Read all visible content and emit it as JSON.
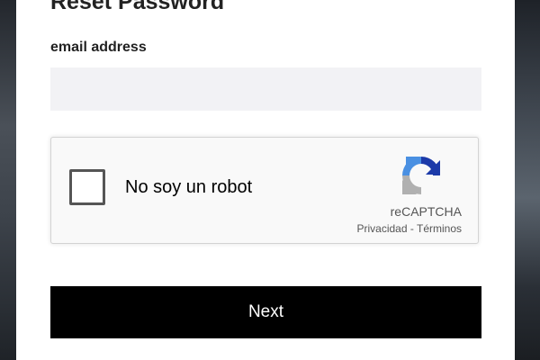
{
  "form": {
    "title": "Reset Password",
    "email_label": "email address",
    "email_value": "",
    "next_label": "Next"
  },
  "recaptcha": {
    "checkbox_label": "No soy un robot",
    "checked": false,
    "brand": "reCAPTCHA",
    "privacy_link": "Privacidad",
    "separator": " - ",
    "terms_link": "Términos",
    "logo_icon": "recaptcha-logo-icon",
    "colors": {
      "blue": "#1c3aa9",
      "light_blue": "#4a90e2",
      "gray": "#b0b0b0"
    }
  },
  "theme": {
    "button_bg": "#000000",
    "input_bg": "#f2f2f5"
  }
}
